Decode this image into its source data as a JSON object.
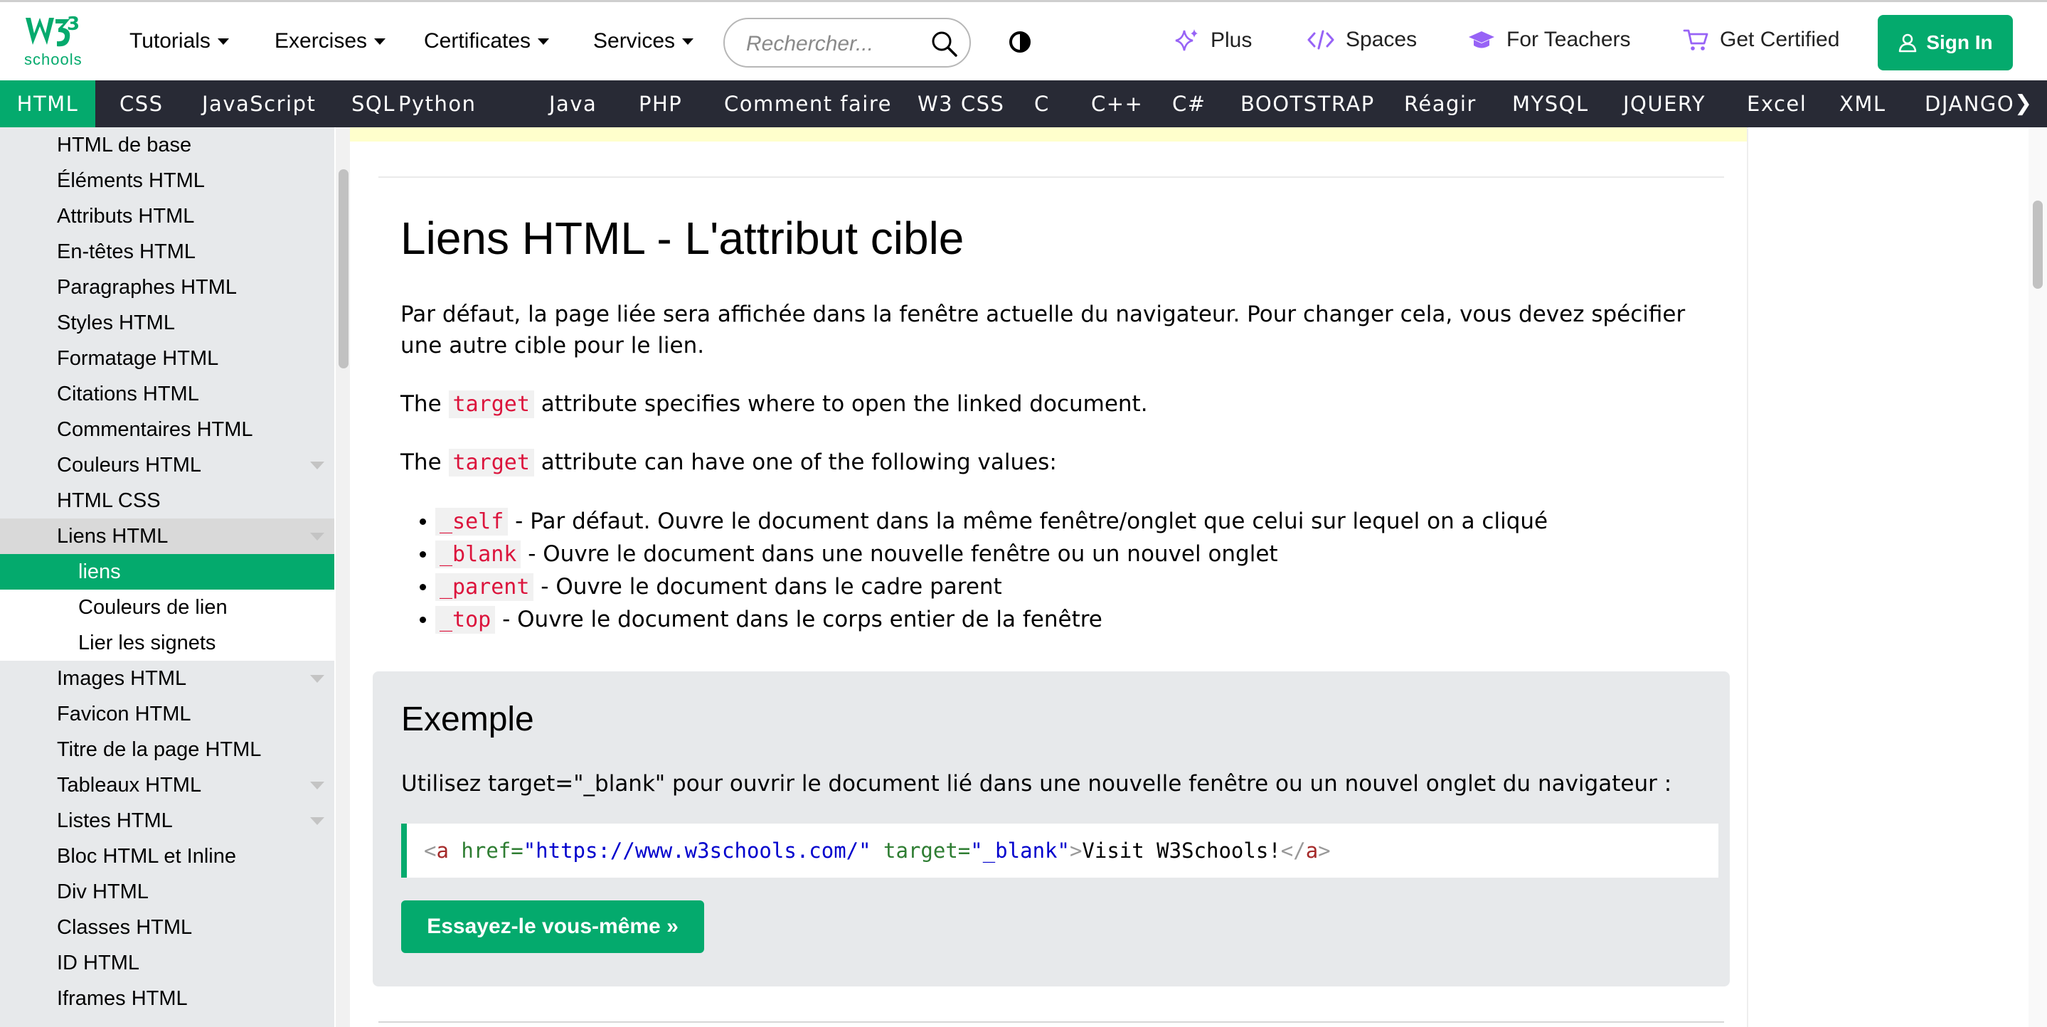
{
  "header": {
    "logo_sup": "3",
    "logo_text": "schools",
    "nav": [
      "Tutorials",
      "Exercises",
      "Certificates",
      "Services"
    ],
    "search_placeholder": "Rechercher...",
    "right_links": [
      "Plus",
      "Spaces",
      "For Teachers",
      "Get Certified"
    ],
    "signin_label": "Sign In",
    "accent": "#04aa6d"
  },
  "subnav": {
    "items": [
      "HTML",
      "CSS",
      "JavaScript",
      "SQL",
      "Python",
      "Java",
      "PHP",
      "Comment faire",
      "W3 CSS",
      "C",
      "C++",
      "C#",
      "BOOTSTRAP",
      "Réagir",
      "MYSQL",
      "JQUERY",
      "Excel",
      "XML",
      "DJANGO"
    ],
    "active": "HTML",
    "more_arrow": "❯"
  },
  "sidebar": {
    "items": [
      "HTML de base",
      "Éléments HTML",
      "Attributs HTML",
      "En-têtes HTML",
      "Paragraphes HTML",
      "Styles HTML",
      "Formatage HTML",
      "Citations HTML",
      "Commentaires HTML",
      "Couleurs HTML",
      "HTML CSS",
      "Liens HTML",
      "liens",
      "Couleurs de lien",
      "Lier les signets",
      "Images HTML",
      "Favicon HTML",
      "Titre de la page HTML",
      "Tableaux HTML",
      "Listes HTML",
      "Bloc HTML et Inline",
      "Div HTML",
      "Classes HTML",
      "ID HTML",
      "Iframes HTML"
    ],
    "selected": "Liens HTML",
    "current": "liens"
  },
  "main": {
    "title": "Liens HTML - L'attribut cible",
    "intro": "Par défaut, la page liée sera affichée dans la fenêtre actuelle du navigateur. Pour changer cela, vous devez spécifier une autre cible pour le lien.",
    "p1_before": "The ",
    "p1_code": "target",
    "p1_after": " attribute specifies where to open the linked document.",
    "p2_before": "The ",
    "p2_code": "target",
    "p2_after": " attribute can have one of the following values:",
    "bullets": [
      {
        "code": "_self",
        "text": " - Par défaut. Ouvre le document dans la même fenêtre/onglet que celui sur lequel on a cliqué"
      },
      {
        "code": "_blank",
        "text": " - Ouvre le document dans une nouvelle fenêtre ou un nouvel onglet"
      },
      {
        "code": "_parent",
        "text": " - Ouvre le document dans le cadre parent"
      },
      {
        "code": "_top",
        "text": " - Ouvre le document dans le corps entier de la fenêtre"
      }
    ]
  },
  "example": {
    "title": "Exemple",
    "text": "Utilisez target=\"_blank\" pour ouvrir le document lié dans une nouvelle fenêtre ou un nouvel onglet du navigateur :",
    "code": {
      "open_br": "<",
      "tag": "a",
      "attr1": " href=",
      "val1": "\"https://www.w3schools.com/\"",
      "attr2": " target=",
      "val2": "\"_blank\"",
      "close_br": ">",
      "link_text": "Visit W3Schools!",
      "end_open": "</",
      "end_tag": "a",
      "end_close": ">"
    },
    "button": "Essayez-le vous-même »"
  }
}
